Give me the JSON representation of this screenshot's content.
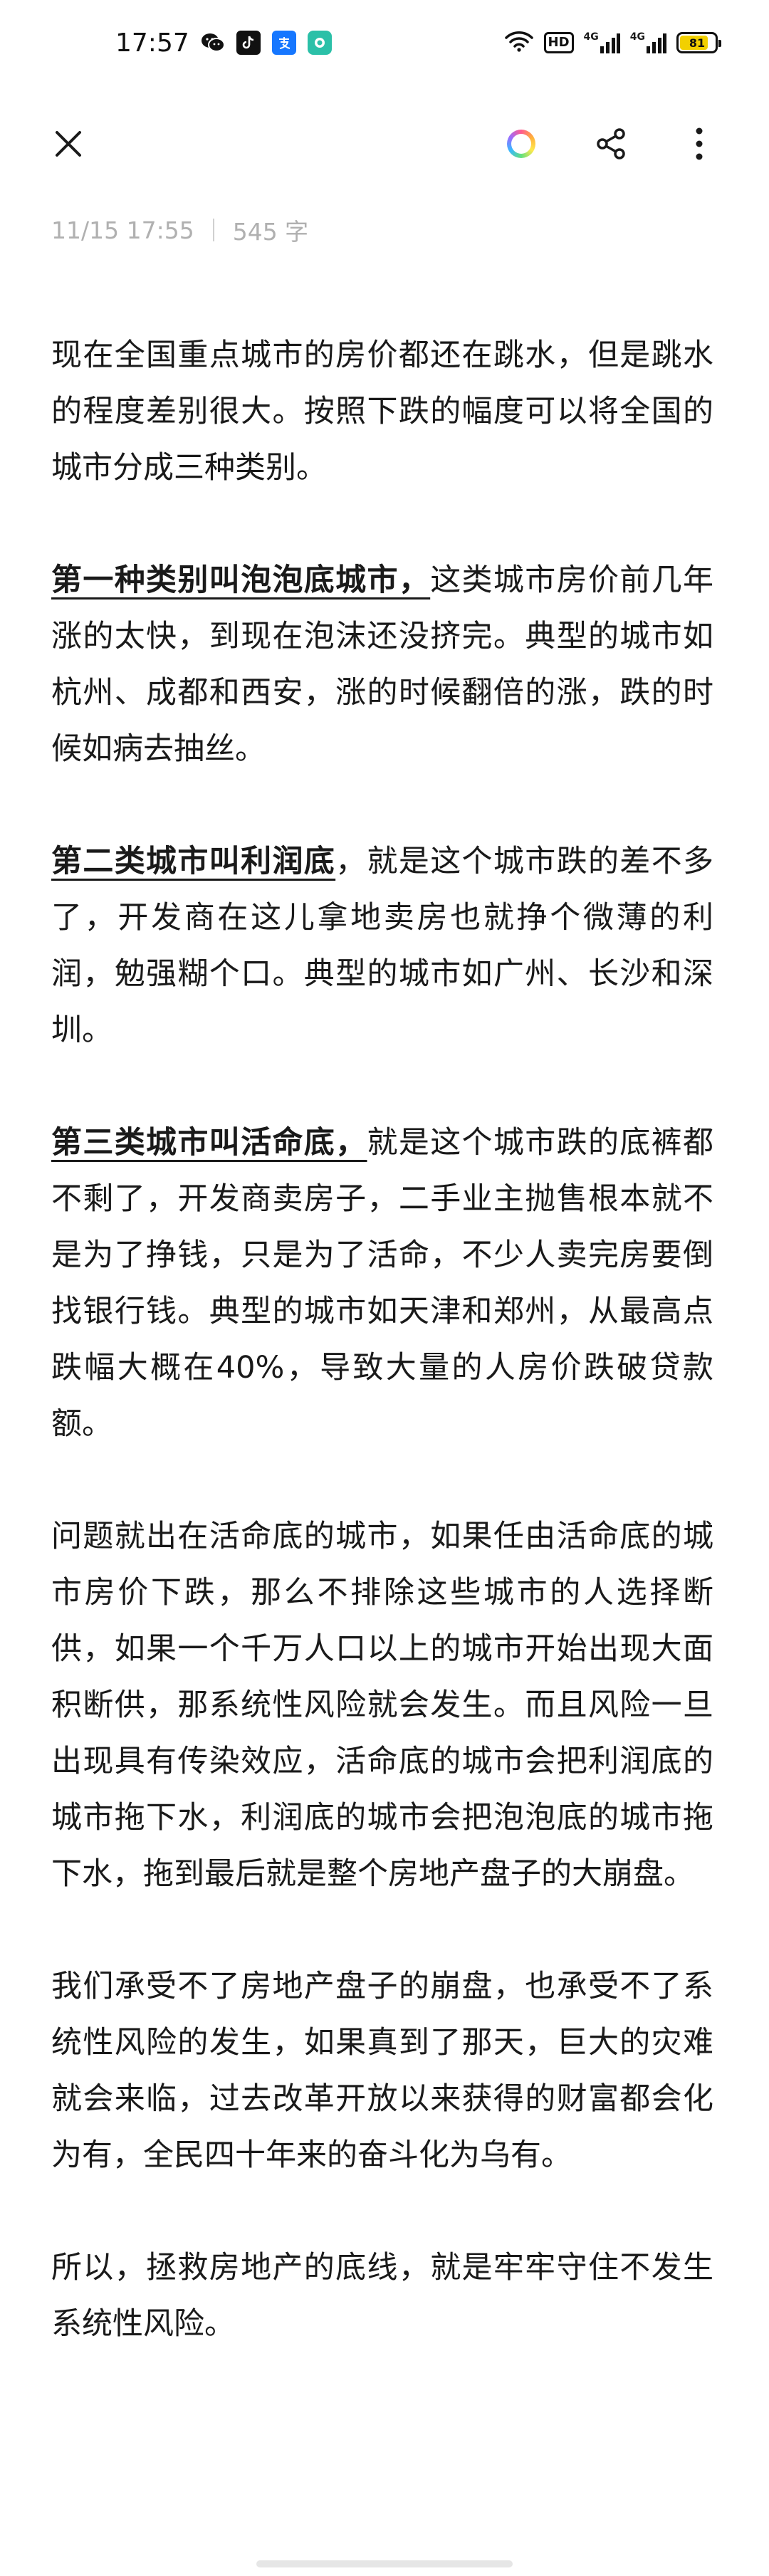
{
  "status_bar": {
    "time": "17:57",
    "app_icons": [
      "wechat-icon",
      "tiktok-icon",
      "alipay-icon",
      "message-icon"
    ],
    "network_badge": "HD",
    "signal_labels": [
      "4G",
      "4G"
    ],
    "battery_level": "81"
  },
  "toolbar": {
    "icons": [
      "close-icon",
      "theme-color-icon",
      "share-icon",
      "more-icon"
    ]
  },
  "note": {
    "timestamp": "11/15 17:55",
    "word_count": "545 字",
    "paragraphs": [
      {
        "heading": "",
        "text": "现在全国重点城市的房价都还在跳水，但是跳水的程度差别很大。按照下跌的幅度可以将全国的城市分成三种类别。"
      },
      {
        "heading": "第一种类别叫泡泡底城市，",
        "text": "这类城市房价前几年涨的太快，到现在泡沫还没挤完。典型的城市如杭州、成都和西安，涨的时候翻倍的涨，跌的时候如病去抽丝。"
      },
      {
        "heading": "第二类城市叫利润底",
        "text": "，就是这个城市跌的差不多了，开发商在这儿拿地卖房也就挣个微薄的利润，勉强糊个口。典型的城市如广州、长沙和深圳。"
      },
      {
        "heading": "第三类城市叫活命底，",
        "text": "就是这个城市跌的底裤都不剩了，开发商卖房子，二手业主抛售根本就不是为了挣钱，只是为了活命，不少人卖完房要倒找银行钱。典型的城市如天津和郑州，从最高点跌幅大概在40%，导致大量的人房价跌破贷款额。"
      },
      {
        "heading": "",
        "text": "问题就出在活命底的城市，如果任由活命底的城市房价下跌，那么不排除这些城市的人选择断供，如果一个千万人口以上的城市开始出现大面积断供，那系统性风险就会发生。而且风险一旦出现具有传染效应，活命底的城市会把利润底的城市拖下水，利润底的城市会把泡泡底的城市拖下水，拖到最后就是整个房地产盘子的大崩盘。"
      },
      {
        "heading": "",
        "text": "我们承受不了房地产盘子的崩盘，也承受不了系统性风险的发生，如果真到了那天，巨大的灾难就会来临，过去改革开放以来获得的财富都会化为有，全民四十年来的奋斗化为乌有。"
      },
      {
        "heading": "",
        "text": "所以，拯救房地产的底线，就是牢牢守住不发生系统性风险。"
      }
    ]
  }
}
